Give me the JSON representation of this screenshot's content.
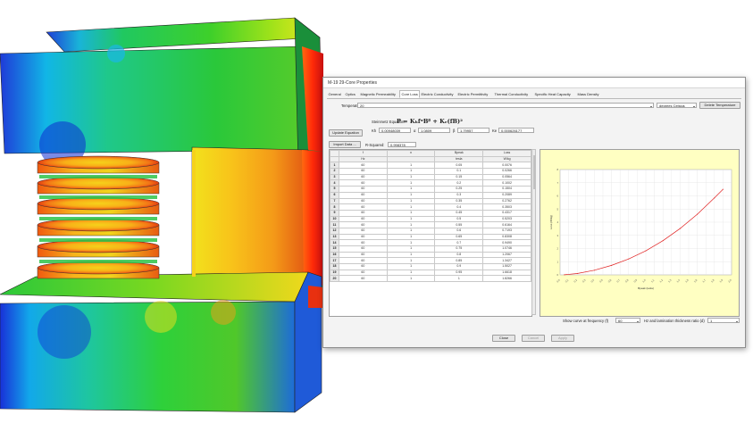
{
  "dialog": {
    "title": "M-19 29-Core Properties",
    "tabs": [
      "General",
      "Optics",
      "Magnetic Permeability",
      "Core Loss",
      "Electric Conductivity",
      "Electric Permittivity",
      "Thermal Conductivity",
      "Specific Heat Capacity",
      "Mass Density"
    ],
    "active_tab": "Core Loss",
    "temperature_label": "Temperature:",
    "temperature_value": "20",
    "unit_value": "degrees Celsius",
    "delete_temperature_label": "Delete Temperature",
    "steinmetz_label": "Steinmetz Equation:",
    "update_equation_label": "Update Equation",
    "params": [
      {
        "label": "Kh",
        "value": "0.00948039"
      },
      {
        "label": "α",
        "value": "1.0809"
      },
      {
        "label": "β",
        "value": "1.79957"
      },
      {
        "label": "Ke",
        "value": "0.000626177"
      }
    ],
    "import_data_label": "Import Data ...",
    "rsquared_label": "R-Squared:",
    "rsquared_value": "0.998378",
    "show_curve_label": "Show curve at frequency (f)",
    "show_curve_value": "60",
    "lamination_label": "Hz and lamination thickness ratio (d)",
    "lamination_value": "1",
    "close_label": "Close",
    "cancel_label": "Cancel",
    "apply_label": "Apply",
    "equation": "P = KₕfᵅBᵝ + Kₑ(fB)²"
  },
  "table": {
    "columns": [
      {
        "name": "f",
        "unit": "Hz"
      },
      {
        "name": "n",
        "unit": ""
      },
      {
        "name": "Bpeak",
        "unit": "tesla"
      },
      {
        "name": "Loss",
        "unit": "W/kg"
      }
    ],
    "rows": [
      [
        "60",
        "1",
        "0.05",
        "0.0076"
      ],
      [
        "60",
        "1",
        "0.1",
        "0.0266"
      ],
      [
        "60",
        "1",
        "0.15",
        "0.0564"
      ],
      [
        "60",
        "1",
        "0.2",
        "0.1002"
      ],
      [
        "60",
        "1",
        "0.25",
        "0.1504"
      ],
      [
        "60",
        "1",
        "0.3",
        "0.2089"
      ],
      [
        "60",
        "1",
        "0.35",
        "0.2762"
      ],
      [
        "60",
        "1",
        "0.4",
        "0.3503"
      ],
      [
        "60",
        "1",
        "0.45",
        "0.4317"
      ],
      [
        "60",
        "1",
        "0.5",
        "0.5203"
      ],
      [
        "60",
        "1",
        "0.55",
        "0.6164"
      ],
      [
        "60",
        "1",
        "0.6",
        "0.7193"
      ],
      [
        "60",
        "1",
        "0.65",
        "0.8308"
      ],
      [
        "60",
        "1",
        "0.7",
        "0.9490"
      ],
      [
        "60",
        "1",
        "0.75",
        "1.0746"
      ],
      [
        "60",
        "1",
        "0.8",
        "1.2067"
      ],
      [
        "60",
        "1",
        "0.85",
        "1.3427"
      ],
      [
        "60",
        "1",
        "0.9",
        "1.5027"
      ],
      [
        "60",
        "1",
        "0.95",
        "1.6618"
      ],
      [
        "60",
        "1",
        "1",
        "1.8266"
      ]
    ]
  },
  "chart_data": {
    "type": "line",
    "title": "",
    "xlabel": "Bpeak (tesla)",
    "ylabel": "Loss (W/kg)",
    "xlim": [
      0,
      2
    ],
    "ylim": [
      0,
      8
    ],
    "grid": true,
    "series": [
      {
        "color": "#e02020",
        "x": [
          0.05,
          0.2,
          0.4,
          0.6,
          0.8,
          1.0,
          1.2,
          1.4,
          1.6,
          1.8,
          1.9
        ],
        "y": [
          0.01,
          0.1,
          0.35,
          0.72,
          1.21,
          1.83,
          2.6,
          3.52,
          4.6,
          5.85,
          6.5
        ]
      }
    ]
  }
}
